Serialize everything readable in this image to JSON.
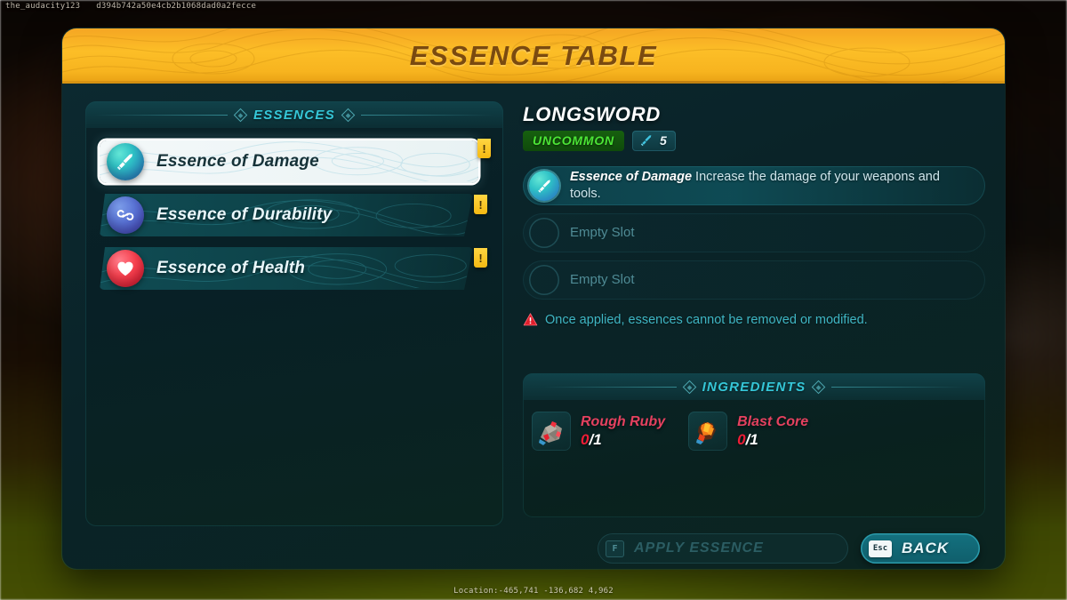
{
  "debug": {
    "username": "the_audacity123",
    "session_hash": "d394b742a50e4cb2b1068dad0a2fecce",
    "location": "Location:-465,741 -136,682 4,962"
  },
  "window": {
    "title": "ESSENCE TABLE"
  },
  "essences_panel": {
    "heading": "ESSENCES",
    "items": [
      {
        "label": "Essence of Damage",
        "icon": "sword-icon",
        "badge": "!",
        "selected": true
      },
      {
        "label": "Essence of Durability",
        "icon": "chain-link-icon",
        "badge": "!",
        "selected": false
      },
      {
        "label": "Essence of Health",
        "icon": "heart-icon",
        "badge": "!",
        "selected": false
      }
    ]
  },
  "item": {
    "name": "LONGSWORD",
    "rarity": "UNCOMMON",
    "stat_icon": "sword-icon",
    "stat_value": "5"
  },
  "slots": [
    {
      "filled": true,
      "icon": "sword-icon",
      "title": "Essence of Damage",
      "description": "Increase the damage of your weapons and tools."
    },
    {
      "filled": false,
      "label": "Empty Slot"
    },
    {
      "filled": false,
      "label": "Empty Slot"
    }
  ],
  "warning": {
    "icon": "warning-triangle-icon",
    "text": "Once applied, essences cannot be removed or modified."
  },
  "ingredients_panel": {
    "heading": "INGREDIENTS",
    "items": [
      {
        "name": "Rough Ruby",
        "icon": "rough-ruby-icon",
        "have": "0",
        "need": "/1"
      },
      {
        "name": "Blast Core",
        "icon": "blast-core-icon",
        "have": "0",
        "need": "/1"
      }
    ]
  },
  "footer": {
    "apply": {
      "key": "F",
      "label": "APPLY ESSENCE",
      "enabled": false
    },
    "back": {
      "key": "Esc",
      "label": "BACK",
      "enabled": true
    }
  },
  "colors": {
    "title_banner": "#fcbe27",
    "title_text": "#7a4a10",
    "accent_teal": "#35c7d8",
    "rarity_uncommon": "#4ce636",
    "ingredient_name": "#e5415f",
    "ingredient_missing": "#f01d36",
    "badge_yellow": "#ffd542",
    "warning_red": "#e01f2c"
  }
}
